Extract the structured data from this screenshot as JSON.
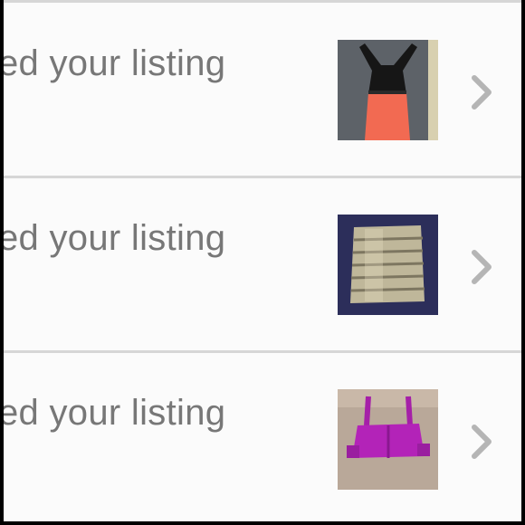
{
  "notifications": [
    {
      "text": "ed your listing",
      "thumbnail": "black-orange-dress-thumbnail",
      "action_icon": "chevron-right-icon"
    },
    {
      "text": "ed your listing",
      "thumbnail": "gold-bandage-skirt-thumbnail",
      "action_icon": "chevron-right-icon"
    },
    {
      "text": "ed your listing",
      "thumbnail": "purple-crop-top-thumbnail",
      "action_icon": "chevron-right-icon"
    }
  ],
  "colors": {
    "text": "#777777",
    "divider": "#d6d6d6",
    "background": "#fbfbfb",
    "chevron": "#b5b5b5"
  }
}
